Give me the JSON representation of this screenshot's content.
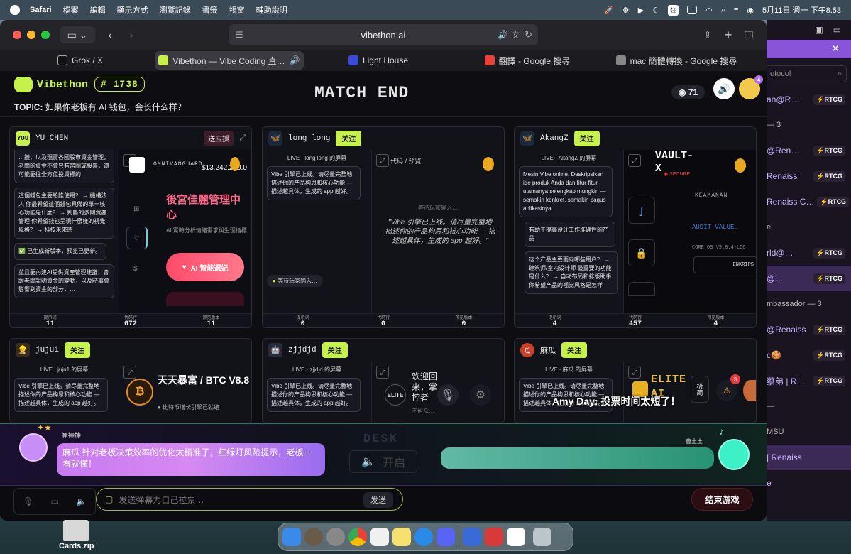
{
  "menubar": {
    "app": "Safari",
    "items": [
      "檔案",
      "編輯",
      "顯示方式",
      "瀏覽記錄",
      "書籤",
      "視窗",
      "輔助說明"
    ],
    "input_badge": "注",
    "clock": "5月11日 週一 下午8:53"
  },
  "browser": {
    "address": "vibethon.ai",
    "tabs": [
      {
        "label": "Grok / X",
        "color": "#111111"
      },
      {
        "label": "Vibethon — Vibe Coding 直…",
        "color": "#c6f04a"
      },
      {
        "label": "Light House",
        "color": "#3a4ad8"
      },
      {
        "label": "翻譯 - Google 搜尋",
        "color": "#ea4335"
      },
      {
        "label": "mac 簡體轉換 - Google 搜尋",
        "color": "#888888"
      }
    ]
  },
  "header": {
    "brand": "Vibethon",
    "room": "# 1738",
    "topic_label": "TOPIC:",
    "topic": "如果你老板有 AI 钱包，会长什么样？",
    "status": "MATCH END",
    "viewers": "◉ 71",
    "avatar_badge": "4"
  },
  "labels": {
    "follow": "关注",
    "give_support": "送应援",
    "prompts": "提示词",
    "code_lines": "代码行",
    "preview_version": "预览版本",
    "you": "YOU"
  },
  "cards": [
    {
      "player": "YU CHEN",
      "live": "",
      "bubbles": [
        "…鏈，以及現實各國股市資金管理，老闆的資金不會只有幣圈或股票，還可能要往全方位投資標的",
        "這個錢包主要給誰使用？ → 機構法人 你最希望這個錢包具備的單一核心功能是什麼？ → 判斷的多關資產管理 你希望錢包呈現什麼樣的視覺風格？ → 科技未來感",
        "✅ 已生成新版本，预览已更新。",
        "並且要內建AI提供資產管理建議，會跟老闆說明資金的變動，以及時事會影響到資金的部分，…"
      ],
      "preview": {
        "brand": "OMNIVANGUARD",
        "amount": "$13,242,260.0",
        "title": "後宮佳麗管理中心",
        "sub": "AI 實時分析情緒需求與生理指標",
        "button": "AI 智能選妃"
      },
      "stats": [
        "11",
        "672",
        "11"
      ]
    },
    {
      "player": "long long",
      "live": "LIVE · long long 的屏幕",
      "bubbles": [
        "Vibe 引擎已上线。请尽量完整地描述你的产品构思和核心功能 — 描述越具体，生成的 app 越好。"
      ],
      "waiting": "等待玩家输入…",
      "preview": {
        "tab": "代码 / 预览",
        "waiting": "等待玩家输入…",
        "quote": "\"Vibe 引擎已上线。请尽量完整地描述你的产品构思和核心功能 — 描述越具体，生成的 app 越好。\""
      },
      "stats": [
        "0",
        "0",
        "0"
      ]
    },
    {
      "player": "AkangZ",
      "live": "LIVE · AkangZ 的屏幕",
      "bubbles": [
        "Mesin Vibe online. Deskripsikan ide produk Anda dan fitur-fitur utamanya selengkap mungkin — semakin konkret, semakin bagus aplikasinya.",
        "有助于提高设计工作准确性的产品",
        "这个产品主要面向哪些用户？ → 建筑师/室内设计师 最重要的功能是什么？ → 自动布局和排版助手 你希望产品的视觉风格是怎样"
      ],
      "preview": {
        "title": "VAULT-X",
        "secure": "◉ SECURE",
        "k1": "KEAMANAN",
        "k2": "AUDIT VALUE…",
        "k3": "CORE OS V9.8.4-LOC",
        "k4": "ENKRIPS"
      },
      "stats": [
        "4",
        "457",
        "4"
      ]
    },
    {
      "player": "juju1",
      "live": "LIVE · juju1 的屏幕",
      "bubbles": [
        "Vibe 引擎已上线。请尽量完整地描述你的产品构思和核心功能 — 描述越具体，生成的 app 越好。"
      ],
      "preview": {
        "title": "天天暴富 / BTC V8.8",
        "sub": "● 比特币增长引擎已就绪"
      }
    },
    {
      "player": "zjjdjd",
      "live": "LIVE · zjjdjd 的屏幕",
      "bubbles": [
        "Vibe 引擎已上线。请尽量完整地描述你的产品构思和核心功能 — 描述越具体，生成的 app 越好。"
      ],
      "preview": {
        "brand": "ELITE",
        "welcome": "欢迎回来，掌控者",
        "sub": "不留众…"
      }
    },
    {
      "player": "麻瓜",
      "live": "LIVE · 麻瓜 的屏幕",
      "bubbles": [
        "Vibe 引擎已上线。请尽量完整地描述你的产品构思和核心功能 — 描述越具体，生成的 app 越好。"
      ],
      "preview": {
        "title": "ELITE AI",
        "mode": "极简",
        "alert_count": "3"
      }
    }
  ],
  "overlay_danmu": "Amy Day: 投票时间太短了！",
  "bottom": {
    "left_name": "崔捧捧",
    "left_message": "麻瓜 针对老板决策效率的优化太精准了，红绿灯风险提示，老板一看就懂！",
    "desk": "DESK",
    "desk_button": "开启",
    "right_name": "曹土土",
    "input_placeholder": "发送弹幕为自己拉票…",
    "send": "发送",
    "end_game": "结束游戏"
  },
  "sidewin": {
    "search_placeholder": "otocol",
    "rows": [
      "an@R…",
      "— 3",
      "@Ren…",
      "Renaiss",
      "Renaiss C…",
      "e",
      "rld@…",
      "@…",
      "mbassador — 3",
      "@Renaiss",
      "c🍪",
      "蔡弟 | R…",
      "—",
      "MSU",
      "| Renaiss",
      "e"
    ],
    "badge": "⚡RTCG"
  },
  "desktop": {
    "file": "Cards.zip"
  }
}
